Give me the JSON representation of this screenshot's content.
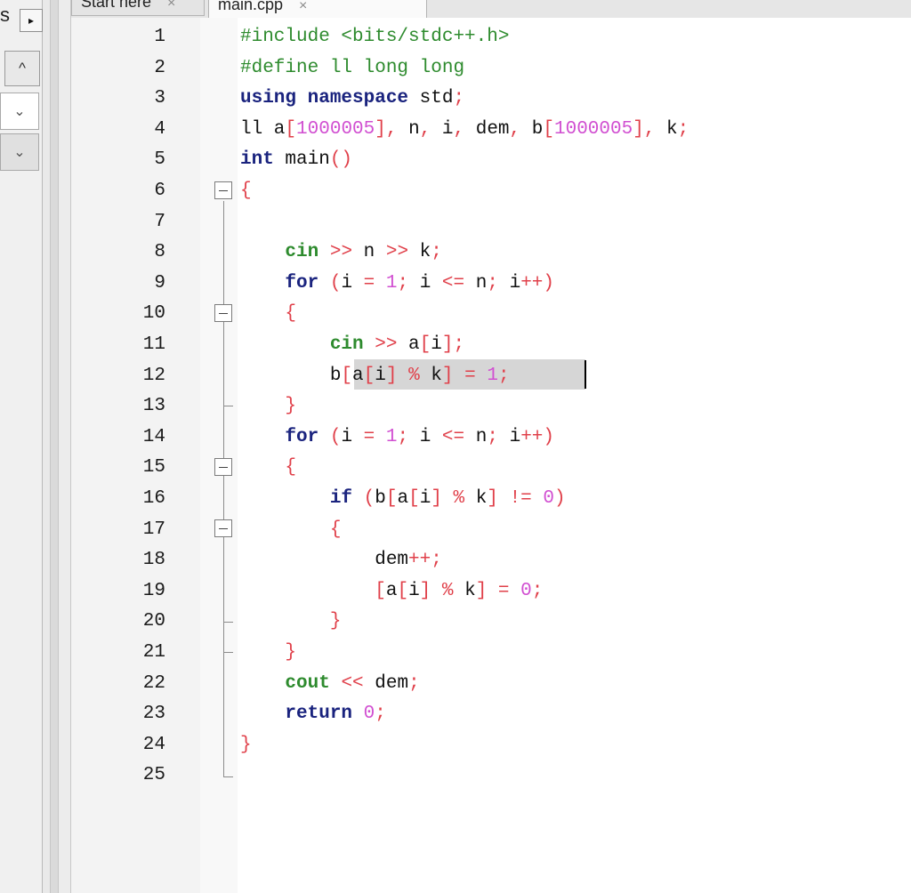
{
  "left_panel": {
    "tab_label": "s",
    "arrow_right": "▸",
    "arrow_up": "^",
    "combo_arrow": "⌄"
  },
  "tabs": [
    {
      "label": "Start here",
      "close": "×",
      "active": false
    },
    {
      "label": "main.cpp",
      "close": "×",
      "active": true
    }
  ],
  "editor": {
    "line_numbers": [
      "1",
      "2",
      "3",
      "4",
      "5",
      "6",
      "7",
      "8",
      "9",
      "10",
      "11",
      "12",
      "13",
      "14",
      "15",
      "16",
      "17",
      "18",
      "19",
      "20",
      "21",
      "22",
      "23",
      "24",
      "25"
    ],
    "current_line": "12",
    "colors": {
      "preprocessor": "#2e8b2e",
      "keyword": "#1a237e",
      "operator": "#e0404a",
      "number": "#d14fd1",
      "current_line_bg": "#d6d6d6"
    },
    "lines": [
      {
        "n": "1",
        "tokens": [
          [
            "pp",
            "#include <bits/stdc++.h>"
          ]
        ]
      },
      {
        "n": "2",
        "tokens": [
          [
            "pp",
            "#define ll long long"
          ]
        ]
      },
      {
        "n": "3",
        "tokens": [
          [
            "kw",
            "using namespace"
          ],
          [
            "id",
            " std"
          ],
          [
            "op",
            ";"
          ]
        ]
      },
      {
        "n": "4",
        "tokens": [
          [
            "id",
            "ll a"
          ],
          [
            "br",
            "["
          ],
          [
            "num",
            "1000005"
          ],
          [
            "br",
            "]"
          ],
          [
            "op",
            ","
          ],
          [
            "id",
            " n"
          ],
          [
            "op",
            ","
          ],
          [
            "id",
            " i"
          ],
          [
            "op",
            ","
          ],
          [
            "id",
            " dem"
          ],
          [
            "op",
            ","
          ],
          [
            "id",
            " b"
          ],
          [
            "br",
            "["
          ],
          [
            "num",
            "1000005"
          ],
          [
            "br",
            "]"
          ],
          [
            "op",
            ","
          ],
          [
            "id",
            " k"
          ],
          [
            "op",
            ";"
          ]
        ]
      },
      {
        "n": "5",
        "tokens": [
          [
            "kw",
            "int"
          ],
          [
            "id",
            " main"
          ],
          [
            "br",
            "()"
          ]
        ]
      },
      {
        "n": "6",
        "tokens": [
          [
            "br",
            "{"
          ]
        ]
      },
      {
        "n": "7",
        "tokens": []
      },
      {
        "n": "8",
        "tokens": [
          [
            "id",
            "    "
          ],
          [
            "fn",
            "cin"
          ],
          [
            "op",
            " >>"
          ],
          [
            "id",
            " n"
          ],
          [
            "op",
            " >>"
          ],
          [
            "id",
            " k"
          ],
          [
            "op",
            ";"
          ]
        ]
      },
      {
        "n": "9",
        "tokens": [
          [
            "id",
            "    "
          ],
          [
            "kw",
            "for"
          ],
          [
            "id",
            " "
          ],
          [
            "br",
            "("
          ],
          [
            "id",
            "i "
          ],
          [
            "op",
            "="
          ],
          [
            "id",
            " "
          ],
          [
            "num",
            "1"
          ],
          [
            "op",
            ";"
          ],
          [
            "id",
            " i "
          ],
          [
            "op",
            "<="
          ],
          [
            "id",
            " n"
          ],
          [
            "op",
            ";"
          ],
          [
            "id",
            " i"
          ],
          [
            "op",
            "++"
          ],
          [
            "br",
            ")"
          ]
        ]
      },
      {
        "n": "10",
        "tokens": [
          [
            "id",
            "    "
          ],
          [
            "br",
            "{"
          ]
        ]
      },
      {
        "n": "11",
        "tokens": [
          [
            "id",
            "        "
          ],
          [
            "fn",
            "cin"
          ],
          [
            "op",
            " >>"
          ],
          [
            "id",
            " a"
          ],
          [
            "br",
            "["
          ],
          [
            "id",
            "i"
          ],
          [
            "br",
            "]"
          ],
          [
            "op",
            ";"
          ]
        ]
      },
      {
        "n": "12",
        "tokens": [
          [
            "id",
            "        b"
          ],
          [
            "br",
            "["
          ],
          [
            "id",
            "a"
          ],
          [
            "br",
            "["
          ],
          [
            "id",
            "i"
          ],
          [
            "br",
            "]"
          ],
          [
            "op",
            " %"
          ],
          [
            "id",
            " k"
          ],
          [
            "br",
            "]"
          ],
          [
            "op",
            " ="
          ],
          [
            "id",
            " "
          ],
          [
            "num",
            "1"
          ],
          [
            "op",
            ";"
          ]
        ]
      },
      {
        "n": "13",
        "tokens": [
          [
            "id",
            "    "
          ],
          [
            "br",
            "}"
          ]
        ]
      },
      {
        "n": "14",
        "tokens": [
          [
            "id",
            "    "
          ],
          [
            "kw",
            "for"
          ],
          [
            "id",
            " "
          ],
          [
            "br",
            "("
          ],
          [
            "id",
            "i "
          ],
          [
            "op",
            "="
          ],
          [
            "id",
            " "
          ],
          [
            "num",
            "1"
          ],
          [
            "op",
            ";"
          ],
          [
            "id",
            " i "
          ],
          [
            "op",
            "<="
          ],
          [
            "id",
            " n"
          ],
          [
            "op",
            ";"
          ],
          [
            "id",
            " i"
          ],
          [
            "op",
            "++"
          ],
          [
            "br",
            ")"
          ]
        ]
      },
      {
        "n": "15",
        "tokens": [
          [
            "id",
            "    "
          ],
          [
            "br",
            "{"
          ]
        ]
      },
      {
        "n": "16",
        "tokens": [
          [
            "id",
            "        "
          ],
          [
            "kw",
            "if"
          ],
          [
            "id",
            " "
          ],
          [
            "br",
            "("
          ],
          [
            "id",
            "b"
          ],
          [
            "br",
            "["
          ],
          [
            "id",
            "a"
          ],
          [
            "br",
            "["
          ],
          [
            "id",
            "i"
          ],
          [
            "br",
            "]"
          ],
          [
            "op",
            " %"
          ],
          [
            "id",
            " k"
          ],
          [
            "br",
            "]"
          ],
          [
            "op",
            " !="
          ],
          [
            "id",
            " "
          ],
          [
            "num",
            "0"
          ],
          [
            "br",
            ")"
          ]
        ]
      },
      {
        "n": "17",
        "tokens": [
          [
            "id",
            "        "
          ],
          [
            "br",
            "{"
          ]
        ]
      },
      {
        "n": "18",
        "tokens": [
          [
            "id",
            "            dem"
          ],
          [
            "op",
            "++;"
          ]
        ]
      },
      {
        "n": "19",
        "tokens": [
          [
            "id",
            "            "
          ],
          [
            "br",
            "["
          ],
          [
            "id",
            "a"
          ],
          [
            "br",
            "["
          ],
          [
            "id",
            "i"
          ],
          [
            "br",
            "]"
          ],
          [
            "op",
            " %"
          ],
          [
            "id",
            " k"
          ],
          [
            "br",
            "]"
          ],
          [
            "op",
            " ="
          ],
          [
            "id",
            " "
          ],
          [
            "num",
            "0"
          ],
          [
            "op",
            ";"
          ]
        ]
      },
      {
        "n": "20",
        "tokens": [
          [
            "id",
            "        "
          ],
          [
            "br",
            "}"
          ]
        ]
      },
      {
        "n": "21",
        "tokens": [
          [
            "id",
            "    "
          ],
          [
            "br",
            "}"
          ]
        ]
      },
      {
        "n": "22",
        "tokens": [
          [
            "id",
            "    "
          ],
          [
            "fn",
            "cout"
          ],
          [
            "op",
            " <<"
          ],
          [
            "id",
            " dem"
          ],
          [
            "op",
            ";"
          ]
        ]
      },
      {
        "n": "23",
        "tokens": [
          [
            "id",
            "    "
          ],
          [
            "kw",
            "return"
          ],
          [
            "id",
            " "
          ],
          [
            "num",
            "0"
          ],
          [
            "op",
            ";"
          ]
        ]
      },
      {
        "n": "24",
        "tokens": [
          [
            "br",
            "}"
          ]
        ]
      },
      {
        "n": "25",
        "tokens": []
      }
    ]
  }
}
